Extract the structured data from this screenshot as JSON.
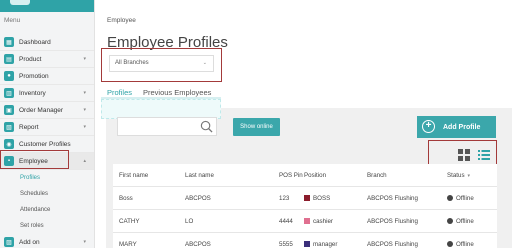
{
  "sidebar": {
    "menu_label": "Menu",
    "items": [
      {
        "label": "Dashboard",
        "icon": "dashboard-icon",
        "chevron": ""
      },
      {
        "label": "Product",
        "icon": "product-icon",
        "chevron": "▾"
      },
      {
        "label": "Promotion",
        "icon": "promotion-icon",
        "chevron": ""
      },
      {
        "label": "Inventory",
        "icon": "inventory-icon",
        "chevron": "▾"
      },
      {
        "label": "Order Manager",
        "icon": "order-icon",
        "chevron": "▾"
      },
      {
        "label": "Report",
        "icon": "report-icon",
        "chevron": "▾"
      },
      {
        "label": "Customer Profiles",
        "icon": "customer-icon",
        "chevron": ""
      },
      {
        "label": "Employee",
        "icon": "employee-icon",
        "chevron": "▴"
      }
    ],
    "sub_items": [
      "Profiles",
      "Schedules",
      "Attendance",
      "Set roles"
    ],
    "add_on": {
      "label": "Add on",
      "chevron": "▾"
    }
  },
  "breadcrumb": "Employee",
  "page_title": "Employee Profiles",
  "branch_select": {
    "value": "All Branches",
    "arrow": "⌄"
  },
  "tabs": {
    "profiles": "Profiles",
    "previous": "Previous Employees"
  },
  "toolbar": {
    "show_online": "Show online",
    "add_profile": "Add Profile",
    "plus": "+"
  },
  "table": {
    "headers": [
      "First name",
      "Last name",
      "POS Pin",
      "Position",
      "Branch",
      "Status"
    ],
    "sort_arrow": "▾",
    "rows": [
      {
        "first": "Boss",
        "last": "ABCPOS",
        "pin": "123",
        "position": "BOSS",
        "position_color": "#8b1d2c",
        "branch": "ABCPOS Flushing",
        "status": "Offline"
      },
      {
        "first": "CATHY",
        "last": "LO",
        "pin": "4444",
        "position": "cashier",
        "position_color": "#e07090",
        "branch": "ABCPOS Flushing",
        "status": "Offline"
      },
      {
        "first": "MARY",
        "last": "ABCPOS",
        "pin": "5555",
        "position": "manager",
        "position_color": "#3b2f7a",
        "branch": "ABCPOS Flushing",
        "status": "Offline"
      }
    ]
  },
  "colors": {
    "accent": "#2fa3a7",
    "highlight_box": "#a33a3a"
  }
}
